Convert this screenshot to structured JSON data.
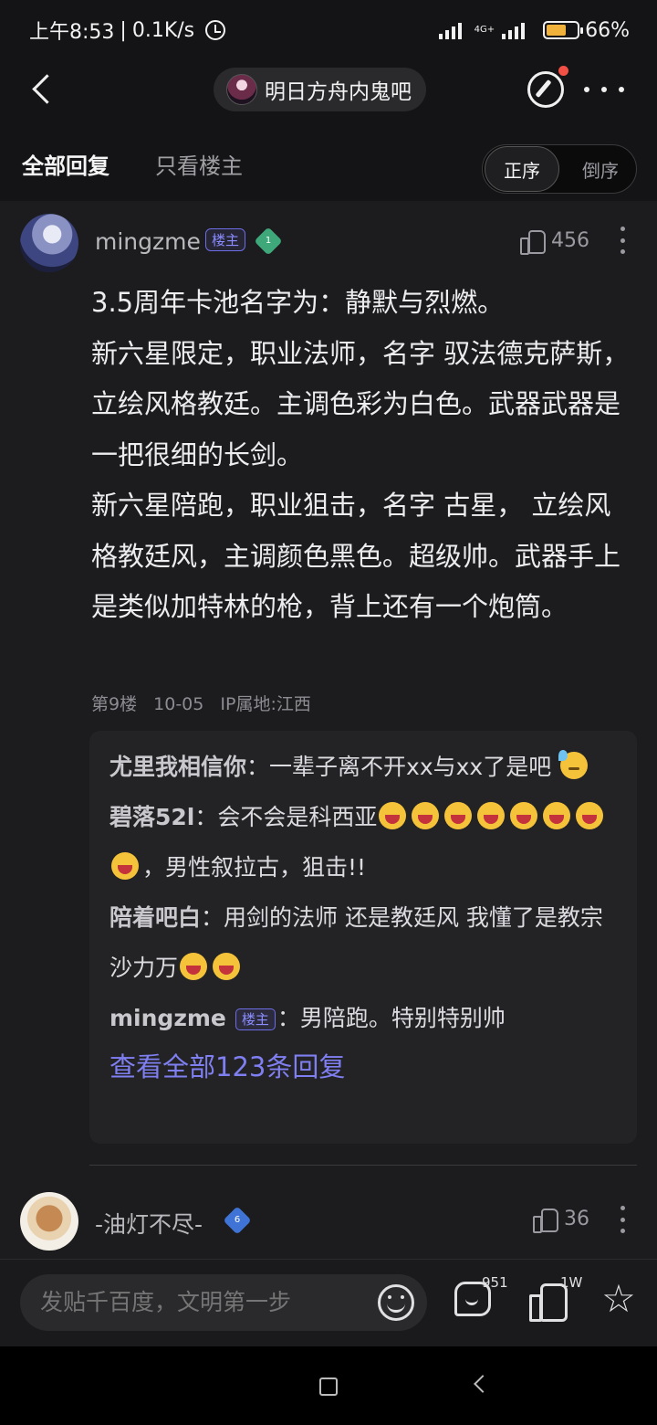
{
  "status_bar": {
    "time": "上午8:53",
    "speed": "0.1K/s",
    "network": "4G+",
    "battery_level": 0.66,
    "battery": "66%"
  },
  "top_nav": {
    "forum_name": "明日方舟内鬼吧"
  },
  "tabs": {
    "all_replies": "全部回复",
    "op_only": "只看楼主",
    "sort_asc": "正序",
    "sort_desc": "倒序"
  },
  "post": {
    "username": "mingzme",
    "op_badge": "楼主",
    "level": "1",
    "likes": "456",
    "paragraphs": [
      "3.5周年卡池名字为：静默与烈燃。",
      "新六星限定，职业法师，名字 驭法德克萨斯，立绘风格教廷。主调色彩为白色。武器武器是一把很细的长剑。",
      "新六星陪跑，职业狙击，名字 古星， 立绘风格教廷风，主调颜色黑色。超级帅。武器手上是类似加特林的枪，背上还有一个炮筒。"
    ],
    "floor": "第9楼",
    "date": "10-05",
    "ip": "IP属地:江西",
    "replies": {
      "r1_user": "尤里我相信你",
      "r1_text": "一辈子离不开xx与xx了是吧",
      "r2_user": "碧落52l",
      "r2_text": "会不会是科西亚",
      "r2_text2": "，男性叙拉古，狙击!!",
      "r3_user": "陪着吧白",
      "r3_text": "用剑的法师 还是教廷风 我懂了是教宗沙力万",
      "r4_user": "mingzme",
      "r4_badge": "楼主",
      "r4_text": "男陪跑。特别特别帅",
      "view_all": "查看全部123条回复"
    }
  },
  "post2": {
    "username": "-油灯不尽-",
    "level": "6",
    "likes": "36"
  },
  "bottom_bar": {
    "placeholder": "发贴千百度，文明第一步",
    "comments_count": "951",
    "likes_count": "1W"
  },
  "colors": {
    "accent": "#7f7ff2",
    "background": "#1c1c1e",
    "level_gem_1": "#3fa87a",
    "level_gem_6": "#3f74d6"
  }
}
